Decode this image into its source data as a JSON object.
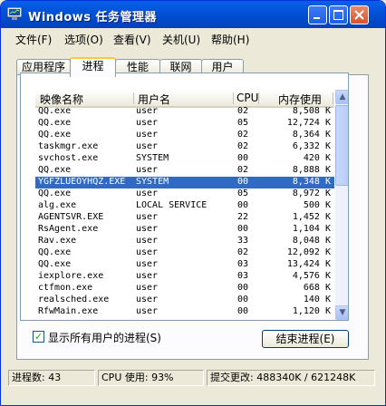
{
  "window": {
    "title": "Windows 任务管理器"
  },
  "menu": [
    {
      "label": "文件(F)"
    },
    {
      "label": "选项(O)"
    },
    {
      "label": "查看(V)"
    },
    {
      "label": "关机(U)"
    },
    {
      "label": "帮助(H)"
    }
  ],
  "tabs": [
    {
      "label": "应用程序"
    },
    {
      "label": "进程"
    },
    {
      "label": "性能"
    },
    {
      "label": "联网"
    },
    {
      "label": "用户"
    }
  ],
  "active_tab": "进程",
  "columns": {
    "name": "映像名称",
    "user": "用户名",
    "cpu": "CPU",
    "mem": "内存使用"
  },
  "processes": [
    {
      "name": "QQ.exe",
      "user": "user",
      "cpu": "02",
      "mem": "8,508 K"
    },
    {
      "name": "QQ.exe",
      "user": "user",
      "cpu": "05",
      "mem": "12,724 K"
    },
    {
      "name": "QQ.exe",
      "user": "user",
      "cpu": "02",
      "mem": "8,364 K"
    },
    {
      "name": "taskmgr.exe",
      "user": "user",
      "cpu": "02",
      "mem": "6,332 K"
    },
    {
      "name": "svchost.exe",
      "user": "SYSTEM",
      "cpu": "00",
      "mem": "420 K"
    },
    {
      "name": "QQ.exe",
      "user": "user",
      "cpu": "02",
      "mem": "8,888 K"
    },
    {
      "name": "YGFZLUEOYHQZ.EXE",
      "user": "SYSTEM",
      "cpu": "00",
      "mem": "8,348 K",
      "selected": true
    },
    {
      "name": "QQ.exe",
      "user": "user",
      "cpu": "05",
      "mem": "8,972 K"
    },
    {
      "name": "alg.exe",
      "user": "LOCAL SERVICE",
      "cpu": "00",
      "mem": "500 K"
    },
    {
      "name": "AGENTSVR.EXE",
      "user": "user",
      "cpu": "22",
      "mem": "1,452 K"
    },
    {
      "name": "RsAgent.exe",
      "user": "user",
      "cpu": "00",
      "mem": "1,104 K"
    },
    {
      "name": "Rav.exe",
      "user": "user",
      "cpu": "33",
      "mem": "8,048 K"
    },
    {
      "name": "QQ.exe",
      "user": "user",
      "cpu": "02",
      "mem": "12,092 K"
    },
    {
      "name": "QQ.exe",
      "user": "user",
      "cpu": "03",
      "mem": "13,424 K"
    },
    {
      "name": "iexplore.exe",
      "user": "user",
      "cpu": "03",
      "mem": "4,576 K"
    },
    {
      "name": "ctfmon.exe",
      "user": "user",
      "cpu": "00",
      "mem": "668 K"
    },
    {
      "name": "realsched.exe",
      "user": "user",
      "cpu": "00",
      "mem": "140 K"
    },
    {
      "name": "RfwMain.exe",
      "user": "user",
      "cpu": "00",
      "mem": "1,120 K"
    }
  ],
  "show_all_users": {
    "label": "显示所有用户的进程(S)",
    "checked": true
  },
  "end_button": {
    "label": "结束进程(E)"
  },
  "status": {
    "processes": "进程数: 43",
    "cpu": "CPU 使用: 93%",
    "commit": "提交更改: 488340K / 621248K"
  }
}
